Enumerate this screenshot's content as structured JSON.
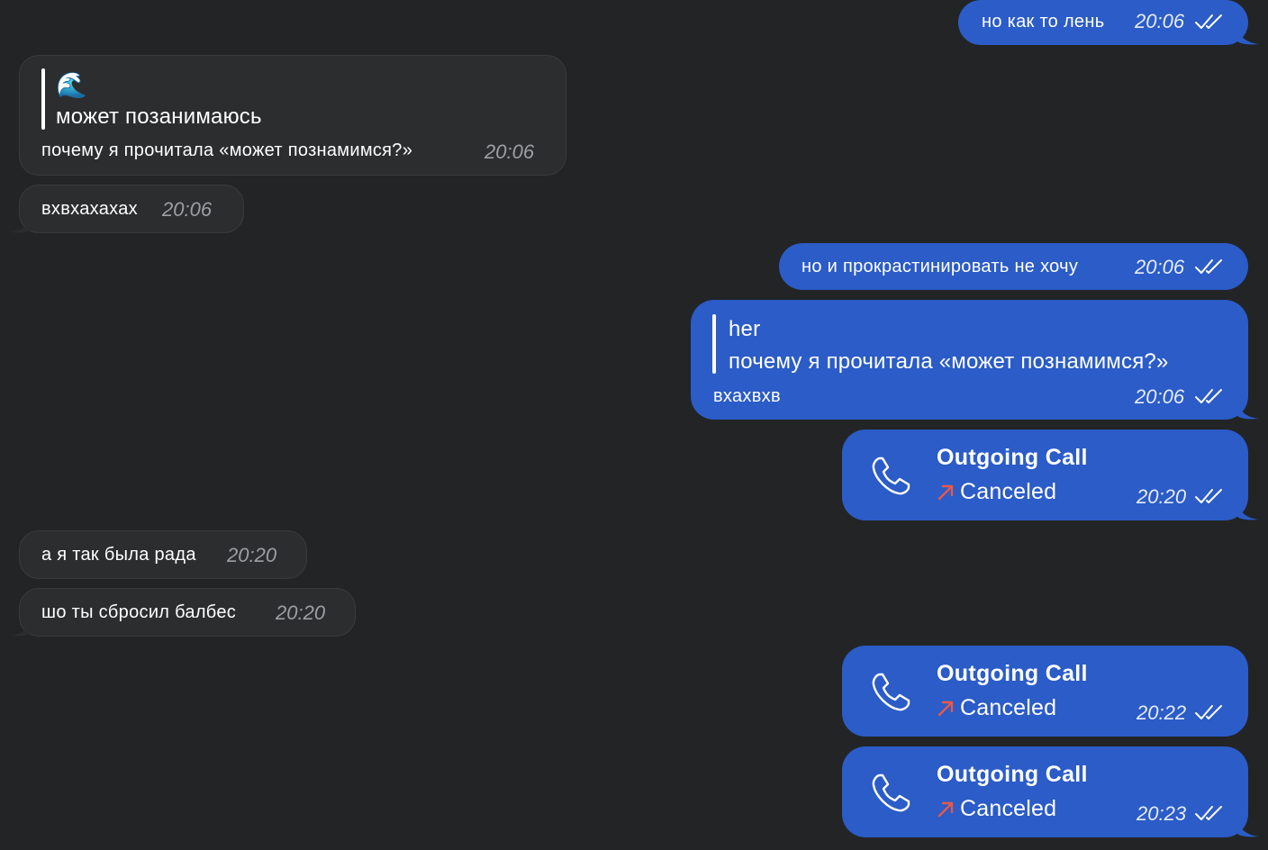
{
  "messages": {
    "m1": {
      "text": "но как то лень",
      "time": "20:06"
    },
    "m2": {
      "emoji": "🌊",
      "quote": "может позанимаюсь",
      "text": "почему я прочитала «может познамимся?»",
      "time": "20:06"
    },
    "m3": {
      "text": "вхвхахахах",
      "time": "20:06"
    },
    "m4": {
      "text": "но и прокрастинировать не хочу",
      "time": "20:06"
    },
    "m5": {
      "quote_author": "her",
      "quote": "почему я прочитала «может познамимся?»",
      "text": "вхахвхв",
      "time": "20:06"
    },
    "m6": {
      "title": "Outgoing Call",
      "status": "Canceled",
      "time": "20:20"
    },
    "m7": {
      "text": "а я так была рада",
      "time": "20:20"
    },
    "m8": {
      "text": "шо ты сбросил балбес",
      "time": "20:20"
    },
    "m9": {
      "title": "Outgoing Call",
      "status": "Canceled",
      "time": "20:22"
    },
    "m10": {
      "title": "Outgoing Call",
      "status": "Canceled",
      "time": "20:23"
    }
  },
  "colors": {
    "background": "#222426",
    "incoming_bubble": "#2c2d2f",
    "outgoing_bubble": "#2b5cc7",
    "canceled_arrow": "#e8584a"
  },
  "icons": {
    "read_receipt": "double-check-icon",
    "call": "phone-icon",
    "call_status": "outgoing-arrow-icon"
  }
}
